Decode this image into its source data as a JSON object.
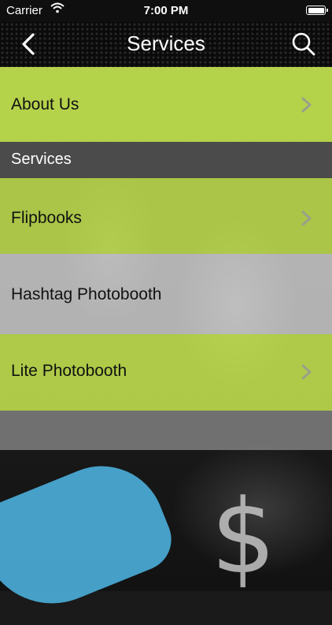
{
  "status_bar": {
    "carrier": "Carrier",
    "time": "7:00 PM"
  },
  "nav": {
    "title": "Services",
    "back_icon": "chevron-left-icon",
    "search_icon": "search-icon"
  },
  "list": {
    "about": "About Us",
    "section_header": "Services",
    "items": [
      "Flipbooks",
      "Hashtag Photobooth",
      "Lite Photobooth"
    ]
  },
  "colors": {
    "green_row": "#c8e950",
    "section_gray": "#4e4e4e",
    "light_row": "#dcdcdc"
  }
}
